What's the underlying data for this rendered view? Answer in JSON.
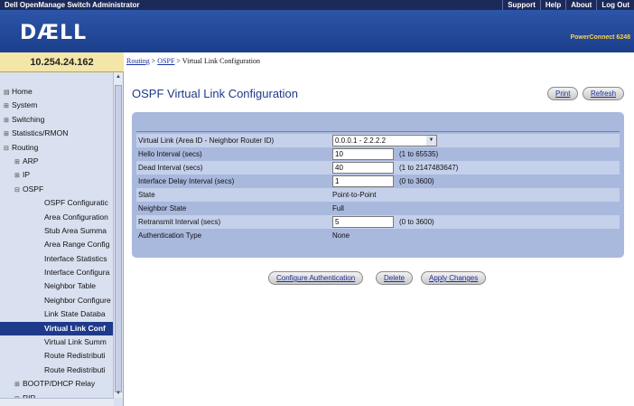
{
  "topbar": {
    "title": "Dell OpenManage Switch Administrator",
    "links": [
      "Support",
      "Help",
      "About",
      "Log Out"
    ]
  },
  "banner": {
    "logo": "DÆLL",
    "model": "PowerConnect 6248"
  },
  "ip": "10.254.24.162",
  "breadcrumb": {
    "routing": "Routing",
    "sep": " > ",
    "ospf": "OSPF",
    "current": "Virtual Link Configuration"
  },
  "sidebar": {
    "items": [
      {
        "label": "Home",
        "toggle": "▤",
        "indent": 0
      },
      {
        "label": "System",
        "toggle": "⊞",
        "indent": 0
      },
      {
        "label": "Switching",
        "toggle": "⊞",
        "indent": 0
      },
      {
        "label": "Statistics/RMON",
        "toggle": "⊞",
        "indent": 0
      },
      {
        "label": "Routing",
        "toggle": "⊟",
        "indent": 0
      },
      {
        "label": "ARP",
        "toggle": "⊞",
        "indent": 1
      },
      {
        "label": "IP",
        "toggle": "⊞",
        "indent": 1
      },
      {
        "label": "OSPF",
        "toggle": "⊟",
        "indent": 1
      },
      {
        "label": "OSPF Configuratic",
        "toggle": "",
        "indent": 3
      },
      {
        "label": "Area Configuration",
        "toggle": "",
        "indent": 3
      },
      {
        "label": "Stub Area Summa",
        "toggle": "",
        "indent": 3
      },
      {
        "label": "Area Range Config",
        "toggle": "",
        "indent": 3
      },
      {
        "label": "Interface Statistics",
        "toggle": "",
        "indent": 3
      },
      {
        "label": "Interface Configura",
        "toggle": "",
        "indent": 3
      },
      {
        "label": "Neighbor Table",
        "toggle": "",
        "indent": 3
      },
      {
        "label": "Neighbor Configure",
        "toggle": "",
        "indent": 3
      },
      {
        "label": "Link State Databa",
        "toggle": "",
        "indent": 3
      },
      {
        "label": "Virtual Link Conf",
        "toggle": "",
        "indent": 3,
        "selected": true
      },
      {
        "label": "Virtual Link Summ",
        "toggle": "",
        "indent": 3
      },
      {
        "label": "Route Redistributi",
        "toggle": "",
        "indent": 3
      },
      {
        "label": "Route Redistributi",
        "toggle": "",
        "indent": 3
      },
      {
        "label": "BOOTP/DHCP Relay",
        "toggle": "⊞",
        "indent": 1
      },
      {
        "label": "RIP",
        "toggle": "⊞",
        "indent": 1
      }
    ]
  },
  "main": {
    "title": "OSPF Virtual Link Configuration",
    "print_label": "Print",
    "refresh_label": "Refresh",
    "fields": {
      "virtual_link": {
        "label": "Virtual Link (Area ID - Neighbor Router ID)",
        "value": "0.0.0.1 - 2.2.2.2"
      },
      "hello": {
        "label": "Hello Interval (secs)",
        "value": "10",
        "range": "(1 to 65535)"
      },
      "dead": {
        "label": "Dead Interval (secs)",
        "value": "40",
        "range": "(1 to 2147483647)"
      },
      "delay": {
        "label": "Interface Delay Interval (secs)",
        "value": "1",
        "range": "(0 to 3600)"
      },
      "state": {
        "label": "State",
        "value": "Point-to-Point"
      },
      "neighbor_state": {
        "label": "Neighbor State",
        "value": "Full"
      },
      "retransmit": {
        "label": "Retransmit Interval (secs)",
        "value": "5",
        "range": "(0 to 3600)"
      },
      "auth_type": {
        "label": "Authentication Type",
        "value": "None"
      }
    },
    "configure_auth_label": "Configure Authentication",
    "delete_label": "Delete",
    "apply_label": "Apply Changes"
  },
  "colors": {
    "topbar": "#1c2a5a",
    "banner": "#2d55a8",
    "panel": "#a9b8dd",
    "selected": "#1e3a8a"
  }
}
